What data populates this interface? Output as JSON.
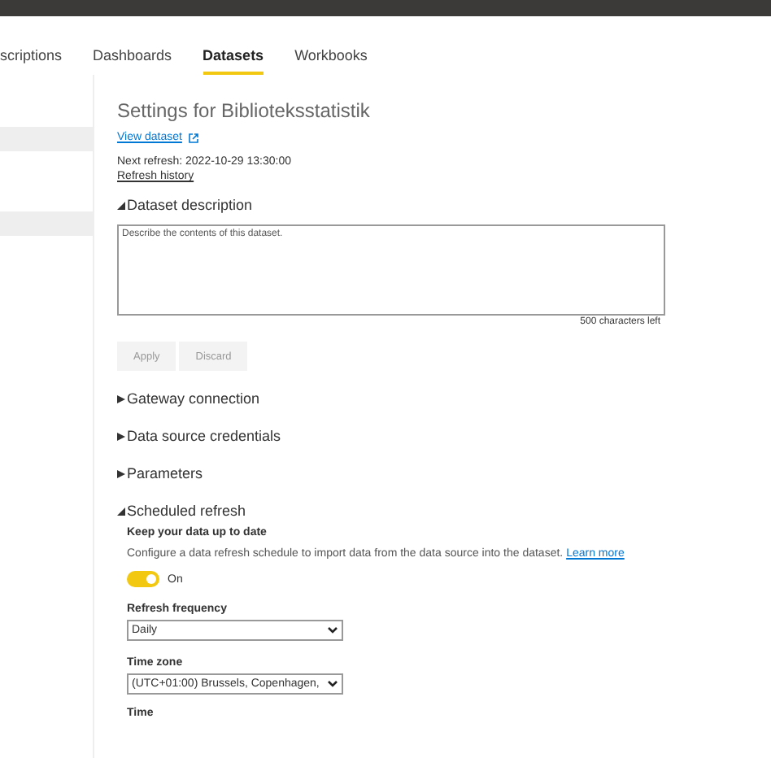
{
  "tabs": [
    {
      "label": "scriptions",
      "selected": false
    },
    {
      "label": "Dashboards",
      "selected": false
    },
    {
      "label": "Datasets",
      "selected": true
    },
    {
      "label": "Workbooks",
      "selected": false
    }
  ],
  "settings": {
    "title": "Settings for Biblioteksstatistik",
    "view_link": "View dataset",
    "next_refresh": "Next refresh: 2022-10-29 13:30:00",
    "history_link": "Refresh history",
    "description_section": {
      "label": "Dataset description",
      "expanded": true,
      "placeholder": "Describe the contents of this dataset.",
      "counter": "500 characters left",
      "buttons": [
        {
          "label": "Apply",
          "disabled": true
        },
        {
          "label": "Discard",
          "disabled": true
        }
      ]
    },
    "sections": [
      {
        "label": "Gateway connection",
        "expanded": false
      },
      {
        "label": "Data source credentials",
        "expanded": false
      },
      {
        "label": "Parameters",
        "expanded": false
      }
    ],
    "scheduled": {
      "label": "Scheduled refresh",
      "expanded": true,
      "heading": "Keep your data up to date",
      "text": "Configure a data refresh schedule to import data from the data source into the dataset.",
      "link": "Learn more",
      "toggle": {
        "on": true,
        "label": "On"
      },
      "fields": [
        {
          "label": "Refresh frequency",
          "value": "Daily"
        },
        {
          "label": "Time zone",
          "value": "(UTC+01:00) Brussels, Copenhagen,"
        }
      ],
      "next_label": "Time"
    }
  }
}
